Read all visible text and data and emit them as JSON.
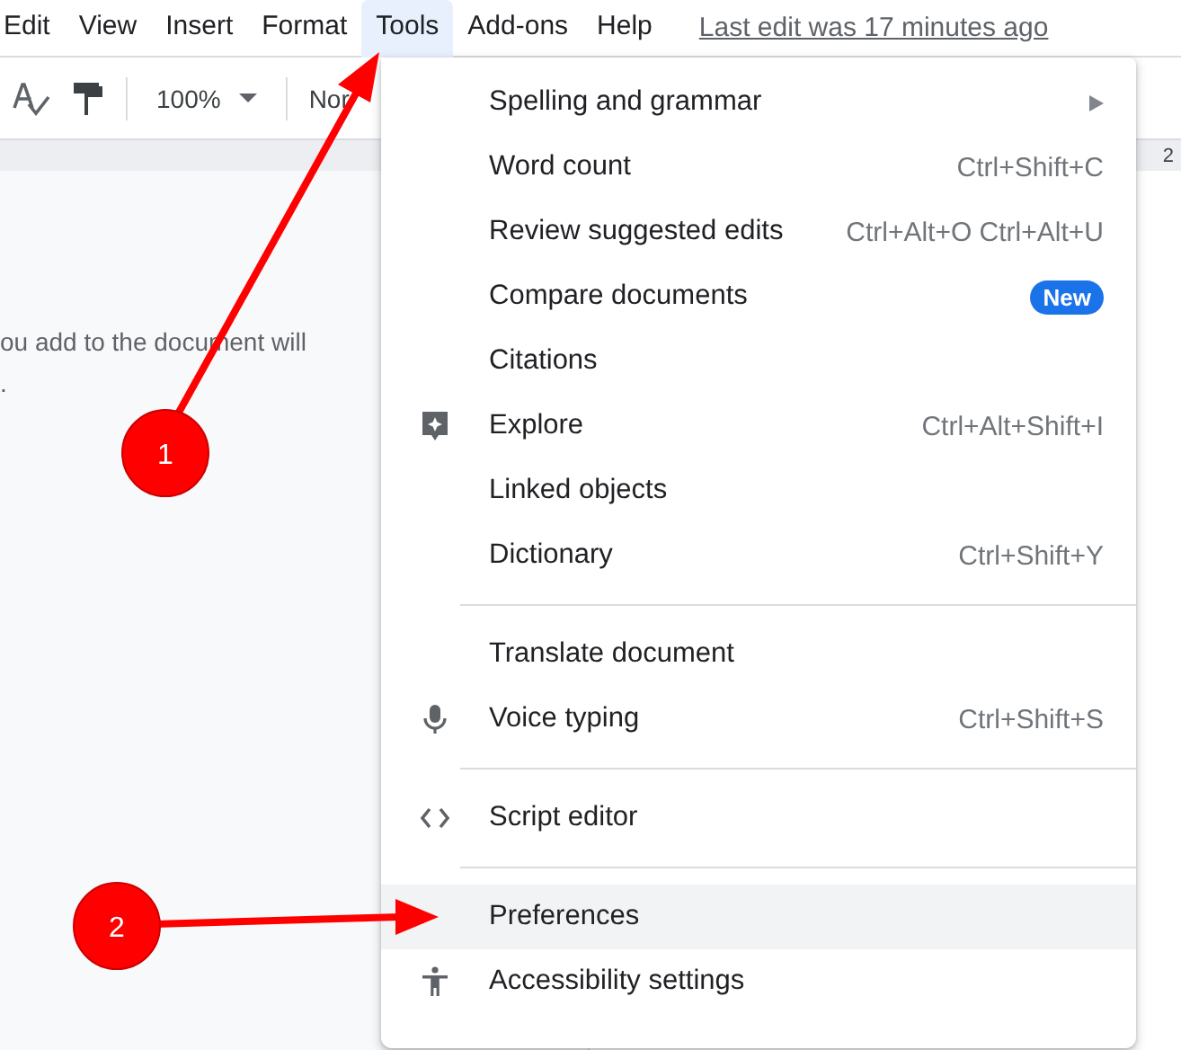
{
  "menubar": {
    "items": [
      {
        "label": "Edit",
        "selected": false
      },
      {
        "label": "View",
        "selected": false
      },
      {
        "label": "Insert",
        "selected": false
      },
      {
        "label": "Format",
        "selected": false
      },
      {
        "label": "Tools",
        "selected": true
      },
      {
        "label": "Add-ons",
        "selected": false
      },
      {
        "label": "Help",
        "selected": false
      }
    ],
    "last_edit": "Last edit was 17 minutes ago"
  },
  "toolbar": {
    "zoom": "100%",
    "style": "Nor"
  },
  "ruler": {
    "mark": "2"
  },
  "document": {
    "lines": [
      "ou add to the document will",
      "."
    ]
  },
  "menu": {
    "sections": [
      {
        "items": [
          {
            "label": "Spelling and grammar",
            "submenu": true,
            "selected": false
          },
          {
            "label": "Word count",
            "shortcut": "Ctrl+Shift+C",
            "selected": false
          },
          {
            "label": "Review suggested edits",
            "shortcut": "Ctrl+Alt+O Ctrl+Alt+U",
            "selected": false
          },
          {
            "label": "Compare documents",
            "badge": "New",
            "selected": false
          },
          {
            "label": "Citations",
            "selected": false
          },
          {
            "label": "Explore",
            "kind": "explore",
            "shortcut": "Ctrl+Alt+Shift+I",
            "selected": false
          },
          {
            "label": "Linked objects",
            "selected": false
          },
          {
            "label": "Dictionary",
            "shortcut": "Ctrl+Shift+Y",
            "selected": false
          }
        ]
      },
      {
        "items": [
          {
            "label": "Translate document",
            "selected": false
          },
          {
            "label": "Voice typing",
            "kind": "mic",
            "shortcut": "Ctrl+Shift+S",
            "selected": false
          }
        ]
      },
      {
        "items": [
          {
            "label": "Script editor",
            "kind": "code",
            "selected": false
          }
        ]
      },
      {
        "items": [
          {
            "label": "Preferences",
            "selected": true
          },
          {
            "label": "Accessibility settings",
            "kind": "accessibility",
            "selected": false
          }
        ]
      }
    ]
  },
  "callouts": [
    {
      "number": "1"
    },
    {
      "number": "2"
    }
  ]
}
